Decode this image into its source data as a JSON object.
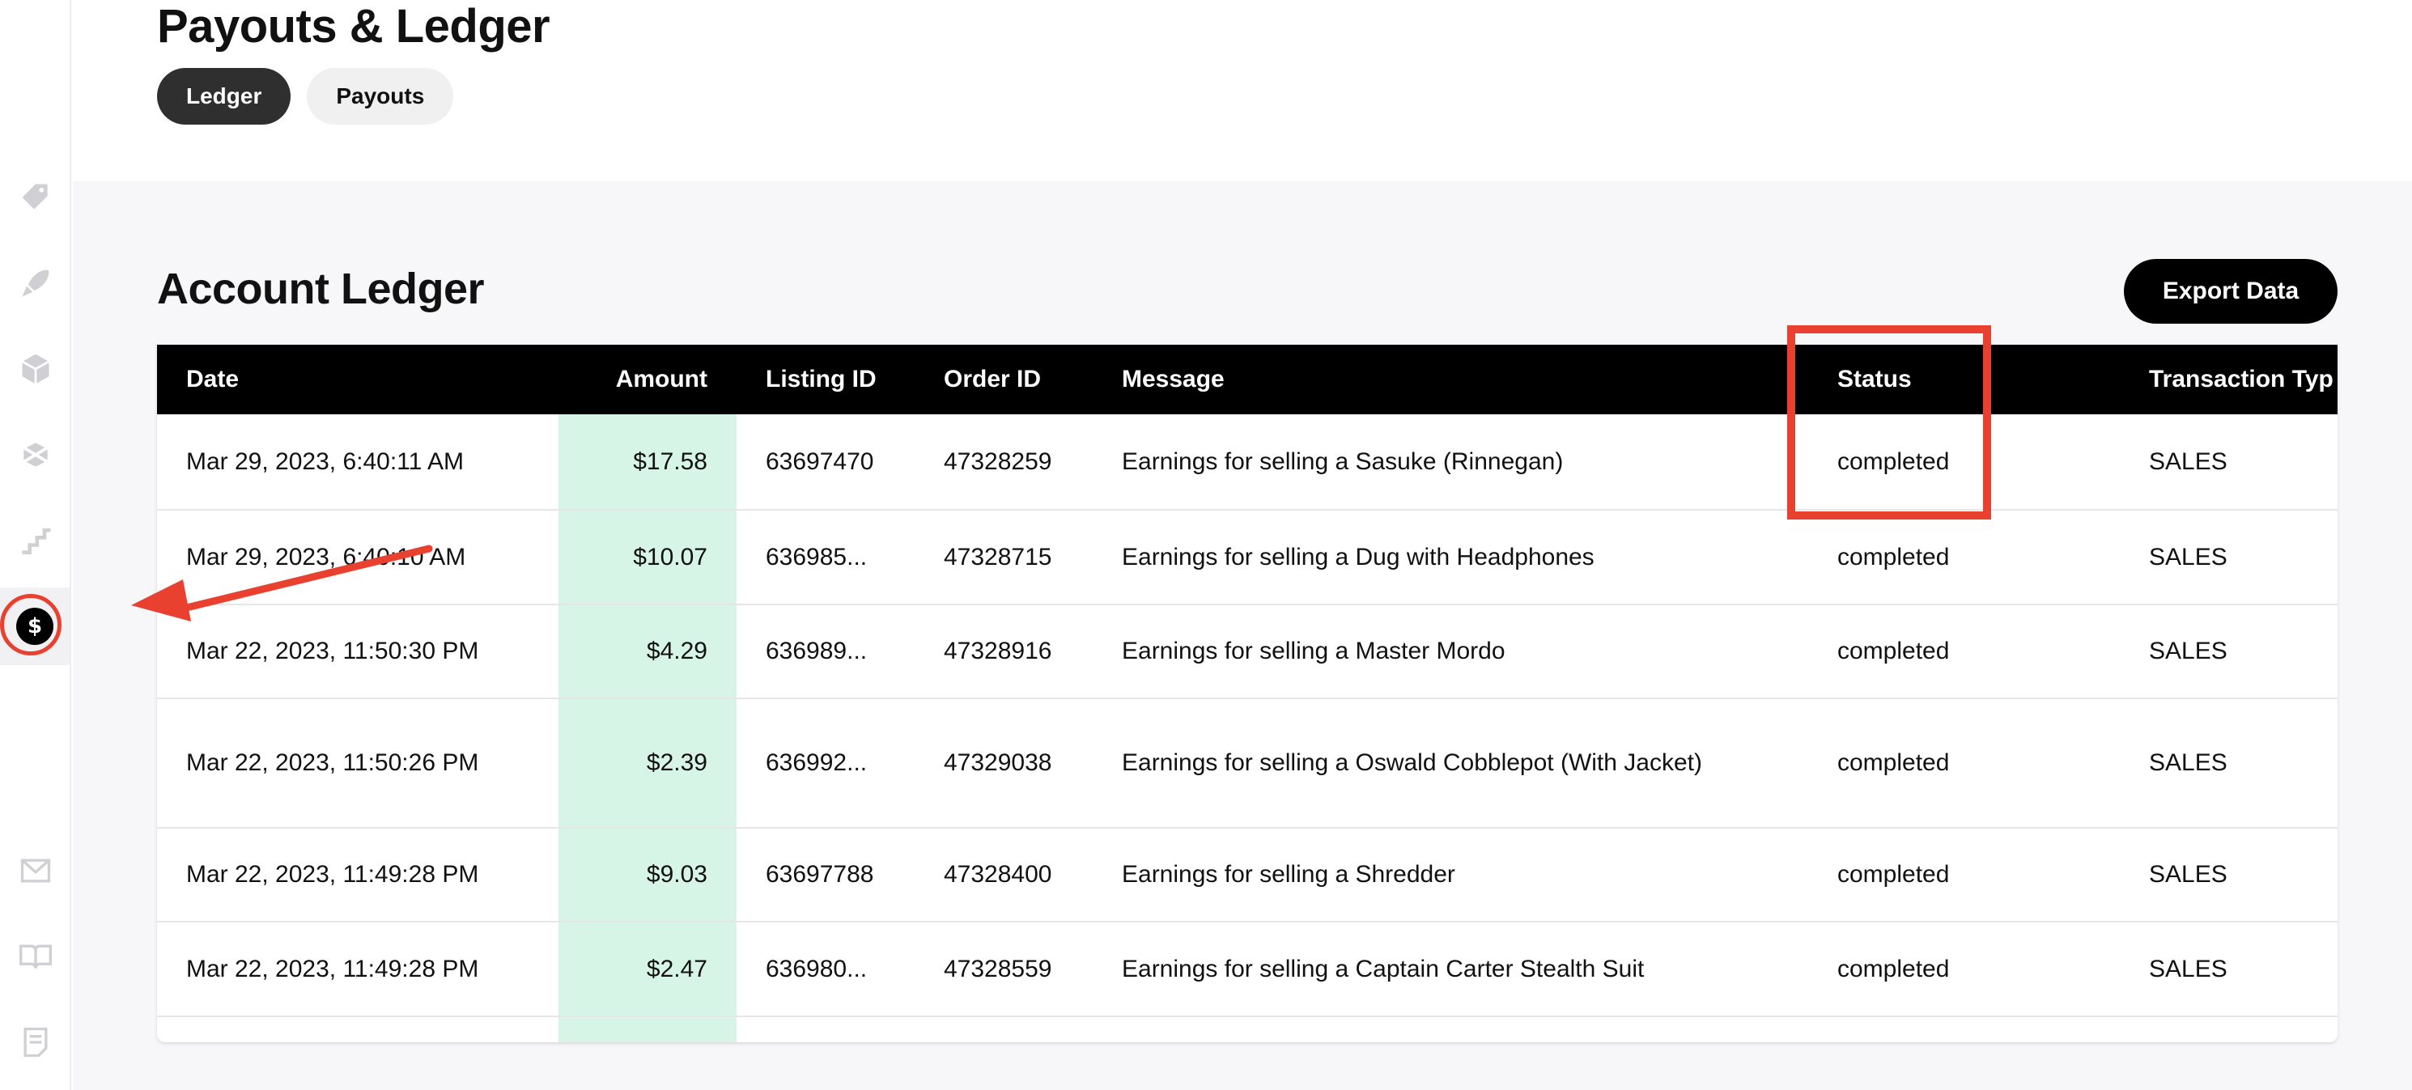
{
  "header": {
    "title": "Payouts & Ledger",
    "tabs": [
      {
        "label": "Ledger",
        "active": true
      },
      {
        "label": "Payouts",
        "active": false
      }
    ]
  },
  "sidebar": {
    "icons": [
      "tag-icon",
      "rocket-icon",
      "box-icon",
      "package-tape-icon",
      "stairs-icon",
      "dollar-icon",
      "mail-icon",
      "book-icon",
      "document-icon"
    ],
    "active": "dollar-icon",
    "active_symbol": "$"
  },
  "ledger": {
    "title": "Account Ledger",
    "export_label": "Export Data",
    "columns": {
      "date": "Date",
      "amount": "Amount",
      "listing_id": "Listing ID",
      "order_id": "Order ID",
      "message": "Message",
      "status": "Status",
      "transaction_type": "Transaction Typ"
    },
    "rows": [
      {
        "date": "Mar 29, 2023, 6:40:11 AM",
        "amount": "$17.58",
        "listing_id": "63697470",
        "order_id": "47328259",
        "message": "Earnings for selling a Sasuke (Rinnegan)",
        "status": "completed",
        "type": "SALES"
      },
      {
        "date": "Mar 29, 2023, 6:40:10 AM",
        "amount": "$10.07",
        "listing_id": "636985...",
        "order_id": "47328715",
        "message": "Earnings for selling a Dug with Headphones",
        "status": "completed",
        "type": "SALES"
      },
      {
        "date": "Mar 22, 2023, 11:50:30 PM",
        "amount": "$4.29",
        "listing_id": "636989...",
        "order_id": "47328916",
        "message": "Earnings for selling a Master Mordo",
        "status": "completed",
        "type": "SALES"
      },
      {
        "date": "Mar 22, 2023, 11:50:26 PM",
        "amount": "$2.39",
        "listing_id": "636992...",
        "order_id": "47329038",
        "message": "Earnings for selling a Oswald Cobblepot (With Jacket)",
        "status": "completed",
        "type": "SALES"
      },
      {
        "date": "Mar 22, 2023, 11:49:28 PM",
        "amount": "$9.03",
        "listing_id": "63697788",
        "order_id": "47328400",
        "message": "Earnings for selling a Shredder",
        "status": "completed",
        "type": "SALES"
      },
      {
        "date": "Mar 22, 2023, 11:49:28 PM",
        "amount": "$2.47",
        "listing_id": "636980...",
        "order_id": "47328559",
        "message": "Earnings for selling a Captain Carter Stealth Suit",
        "status": "completed",
        "type": "SALES"
      }
    ]
  },
  "colors": {
    "accent_annotation": "#e8412f",
    "amount_highlight": "#d7f5e6",
    "header_bg": "#000000"
  }
}
